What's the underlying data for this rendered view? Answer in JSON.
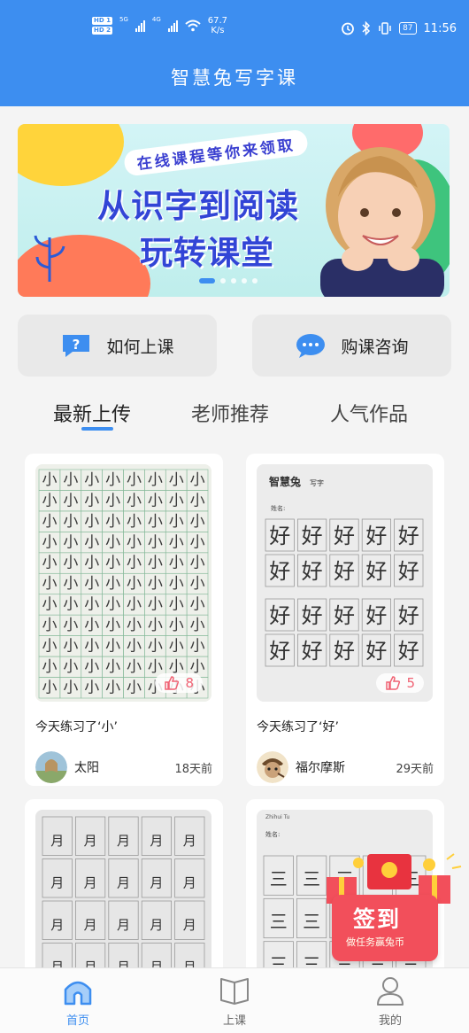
{
  "status": {
    "hd1": "HD 1",
    "hd2": "HD 2",
    "net1": "5G",
    "net2": "4G",
    "speed_value": "67.7",
    "speed_unit": "K/s",
    "battery": "87",
    "time": "11:56"
  },
  "app": {
    "title": "智慧兔写字课"
  },
  "banner": {
    "ribbon": "在线课程等你来领取",
    "line1": "从识字到阅读",
    "line2": "玩转课堂",
    "active_slide": 1,
    "slides": 5
  },
  "quick": [
    {
      "label": "如何上课",
      "icon": "question-bubble-icon"
    },
    {
      "label": "购课咨询",
      "icon": "chat-bubble-icon"
    }
  ],
  "tabs": [
    {
      "label": "最新上传",
      "active": true
    },
    {
      "label": "老师推荐",
      "active": false
    },
    {
      "label": "人气作品",
      "active": false
    }
  ],
  "cards": [
    {
      "desc": "今天练习了‘小’",
      "likes": "8",
      "user": "太阳",
      "ago": "18天前",
      "char": "小"
    },
    {
      "desc": "今天练习了‘好’",
      "likes": "5",
      "user": "福尔摩斯",
      "ago": "29天前",
      "char": "好",
      "brand": "智慧兔",
      "brand_sub": "写字",
      "name_label": "姓名:"
    },
    {
      "char": "月"
    },
    {
      "char": "三",
      "brand_sub": "Zhihui Tu",
      "name_label": "姓名:"
    }
  ],
  "promo": {
    "title": "签到",
    "sub": "做任务赢兔币"
  },
  "nav": [
    {
      "label": "首页",
      "icon": "home-icon",
      "active": true
    },
    {
      "label": "上课",
      "icon": "book-icon",
      "active": false
    },
    {
      "label": "我的",
      "icon": "profile-icon",
      "active": false
    }
  ],
  "colors": {
    "primary": "#3d8ef0",
    "like": "#f06273",
    "promo": "#f24f5b"
  }
}
